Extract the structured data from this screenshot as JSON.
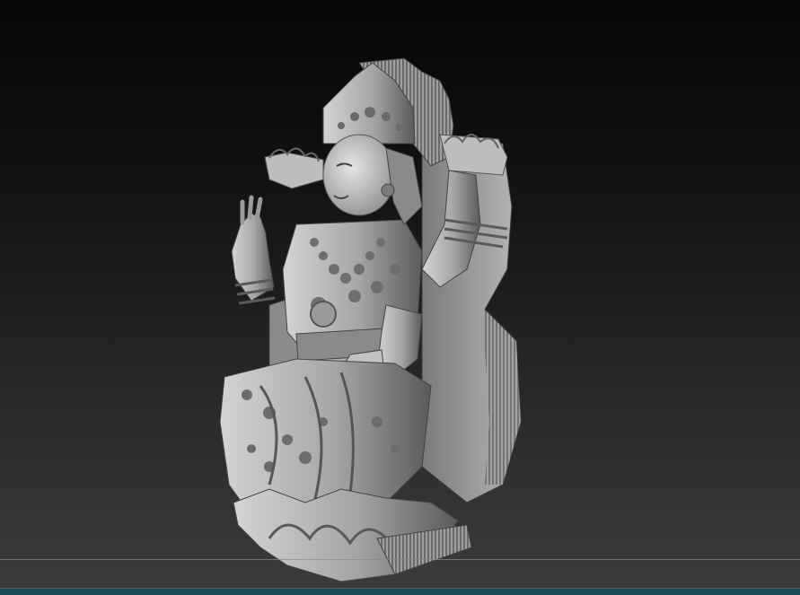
{
  "viewport": {
    "model_name": "",
    "subject": "lakshmi-relief-sculpture"
  },
  "colors": {
    "background_top": "#050505",
    "background_bottom": "#3b3b3b",
    "material_light": "#cfcfcf",
    "material_mid": "#8f8f8f",
    "material_dark": "#4a4a4a",
    "status_bar": "#1d4a56"
  }
}
